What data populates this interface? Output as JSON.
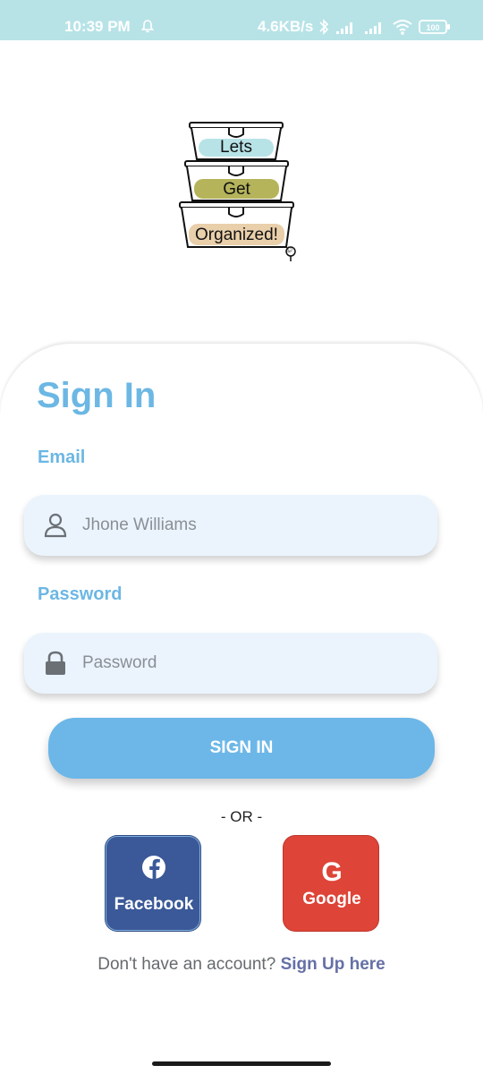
{
  "status_bar": {
    "time": "10:39 PM",
    "network_speed": "4.6KB/s",
    "battery": "100",
    "icons": [
      "notification-bell-icon",
      "bluetooth-icon",
      "signal-icon",
      "signal-icon",
      "wifi-icon",
      "battery-icon"
    ]
  },
  "logo": {
    "line1": "Lets",
    "line2": "Get",
    "line3": "Organized!",
    "mark": "©",
    "colors": [
      "#b7e3e7",
      "#b5b45a",
      "#e9cfaa"
    ]
  },
  "signin": {
    "title": "Sign In",
    "email_label": "Email",
    "email_placeholder": "Jhone Williams",
    "password_label": "Password",
    "password_placeholder": "Password",
    "button_label": "SIGN IN",
    "or_text": "- OR -"
  },
  "social": {
    "facebook_label": "Facebook",
    "google_label": "Google",
    "google_glyph": "G"
  },
  "footer": {
    "prompt": "Don't have an account?",
    "link": "Sign Up here"
  },
  "colors": {
    "accent": "#6cb7e4",
    "status_bar": "#b7e3e7",
    "input_bg": "#ebf4fd",
    "facebook": "#3b5998",
    "google": "#de4437",
    "link": "#6570a6"
  }
}
